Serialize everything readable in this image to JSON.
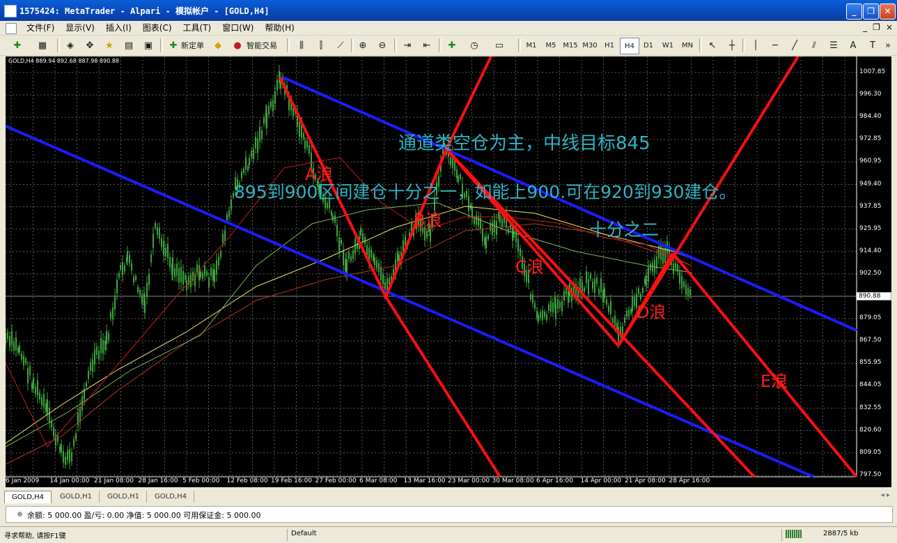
{
  "window": {
    "title": "1575424: MetaTrader - Alpari - 模拟帐户 - [GOLD,H4]",
    "buttons": [
      "_",
      "❐",
      "✕"
    ]
  },
  "menu": {
    "items": [
      "文件(F)",
      "显示(V)",
      "插入(I)",
      "图表(C)",
      "工具(T)",
      "窗口(W)",
      "帮助(H)"
    ],
    "mdi_controls": [
      "_",
      "❐",
      "×"
    ]
  },
  "toolbar": {
    "new_order_label": "新定单",
    "expert_label": "智能交易",
    "timeframes": [
      "M1",
      "M5",
      "M15",
      "M30",
      "H1",
      "H4",
      "D1",
      "W1",
      "MN"
    ],
    "active_timeframe": "H4",
    "text_tool": "A",
    "colors": {
      "accent": "#1550c8"
    }
  },
  "chart": {
    "symbol_info": "GOLD,H4  889.94 892.68 887.98 890.88",
    "current_price": "890.88",
    "price_labels": [
      "1007.85",
      "996.30",
      "984.40",
      "972.85",
      "960.95",
      "949.40",
      "937.85",
      "925.95",
      "914.40",
      "902.50",
      "890.88",
      "879.05",
      "867.50",
      "855.95",
      "844.05",
      "832.55",
      "820.60",
      "809.05",
      "797.50"
    ],
    "time_labels": [
      "6 Jan 2009",
      "14 Jan 00:00",
      "21 Jan 08:00",
      "28 Jan 16:00",
      "5 Feb 00:00",
      "12 Feb 08:00",
      "19 Feb 16:00",
      "27 Feb 00:00",
      "6 Mar 08:00",
      "13 Mar 16:00",
      "23 Mar 00:00",
      "30 Mar 08:00",
      "6 Apr 16:00",
      "14 Apr 00:00",
      "21 Apr 08:00",
      "28 Apr 16:00"
    ],
    "annotations": {
      "line1": "通道类空仓为主，中线目标845",
      "line2": "895到900区间建仓十分之一，如能上900.可在920到930建仓。",
      "line3": "十分之二",
      "wave_a": "A浪",
      "wave_b": "B浪",
      "wave_c": "C浪",
      "wave_d": "D浪",
      "wave_e": "E浪"
    },
    "colors": {
      "background": "#000000",
      "candles": "#3ea53e",
      "channel": "#1c1cff",
      "waves": "#ff0f0f",
      "annotation_text": "#2fb3c4",
      "wave_text": "#ff1e1e",
      "ma_red": "#c81c1c",
      "ma_yellow": "#e9e96a",
      "ma_green": "#7ab95a",
      "ma_darkred": "#b03a2a"
    }
  },
  "tabs": {
    "items": [
      "GOLD,H4",
      "GOLD,H1",
      "GOLD,H1",
      "GOLD,H4"
    ],
    "active_index": 0,
    "nav": "◂ ▸"
  },
  "account": {
    "text": "余额: 5 000.00  盈/亏: 0.00  净值: 5 000.00  可用保证金: 5 000.00"
  },
  "status": {
    "help": "寻求帮助, 请按F1键",
    "profile": "Default",
    "traffic": "2887/5 kb"
  }
}
